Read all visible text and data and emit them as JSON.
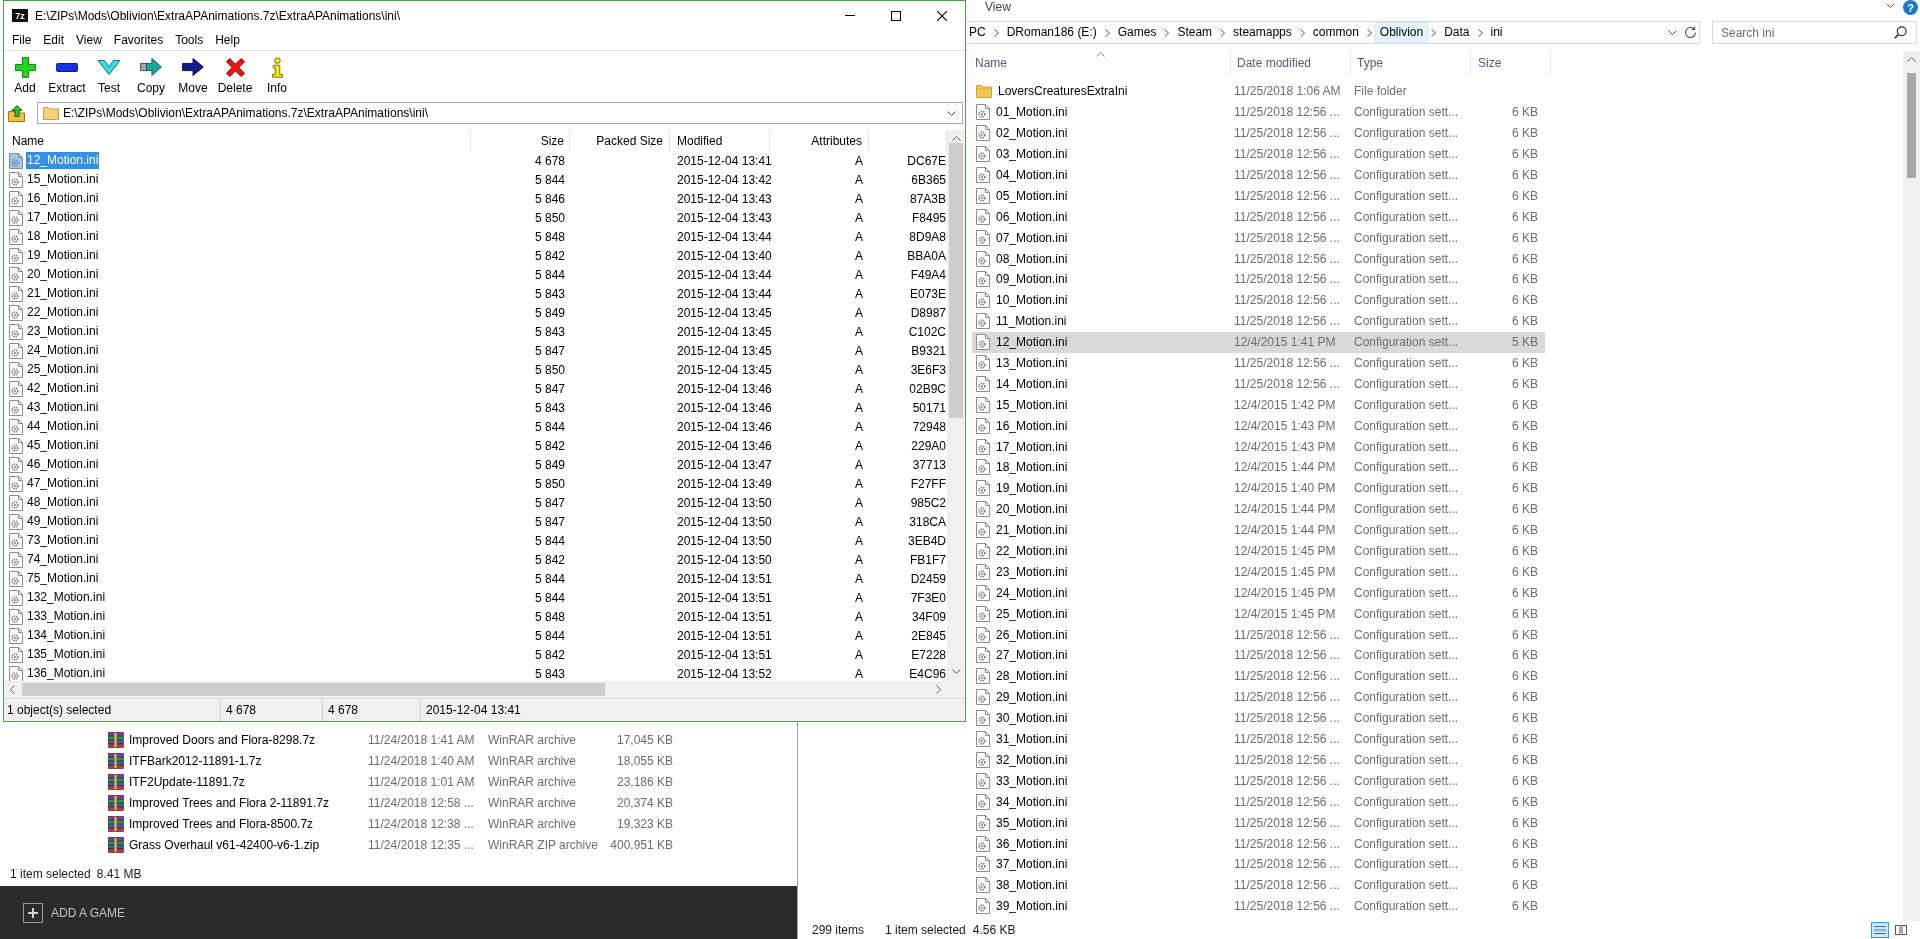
{
  "sevenzip": {
    "logo": "7z",
    "title": "E:\\ZIPs\\Mods\\Oblivion\\ExtraAPAnimations.7z\\ExtraAPAnimations\\ini\\",
    "menu": [
      "File",
      "Edit",
      "View",
      "Favorites",
      "Tools",
      "Help"
    ],
    "toolbar": [
      {
        "kind": "add",
        "label": "Add"
      },
      {
        "kind": "extract",
        "label": "Extract"
      },
      {
        "kind": "test",
        "label": "Test"
      },
      {
        "kind": "copy",
        "label": "Copy"
      },
      {
        "kind": "move",
        "label": "Move"
      },
      {
        "kind": "delete",
        "label": "Delete"
      },
      {
        "kind": "info",
        "label": "Info"
      }
    ],
    "path": "E:\\ZIPs\\Mods\\Oblivion\\ExtraAPAnimations.7z\\ExtraAPAnimations\\ini\\",
    "columns": [
      "Name",
      "Size",
      "Packed Size",
      "Modified",
      "Attributes"
    ],
    "rows": [
      {
        "name": "12_Motion.ini",
        "size": "4 678",
        "modified": "2015-12-04 13:41",
        "attributes": "A",
        "column_6": "DC67E",
        "selected": true
      },
      {
        "name": "15_Motion.ini",
        "size": "5 844",
        "modified": "2015-12-04 13:42",
        "attributes": "A",
        "column_6": "6B365",
        "selected": false
      },
      {
        "name": "16_Motion.ini",
        "size": "5 846",
        "modified": "2015-12-04 13:43",
        "attributes": "A",
        "column_6": "87A3B",
        "selected": false
      },
      {
        "name": "17_Motion.ini",
        "size": "5 850",
        "modified": "2015-12-04 13:43",
        "attributes": "A",
        "column_6": "F8495",
        "selected": false
      },
      {
        "name": "18_Motion.ini",
        "size": "5 848",
        "modified": "2015-12-04 13:44",
        "attributes": "A",
        "column_6": "8D9A8",
        "selected": false
      },
      {
        "name": "19_Motion.ini",
        "size": "5 842",
        "modified": "2015-12-04 13:40",
        "attributes": "A",
        "column_6": "BBA0A",
        "selected": false
      },
      {
        "name": "20_Motion.ini",
        "size": "5 844",
        "modified": "2015-12-04 13:44",
        "attributes": "A",
        "column_6": "F49A4",
        "selected": false
      },
      {
        "name": "21_Motion.ini",
        "size": "5 843",
        "modified": "2015-12-04 13:44",
        "attributes": "A",
        "column_6": "E073E",
        "selected": false
      },
      {
        "name": "22_Motion.ini",
        "size": "5 849",
        "modified": "2015-12-04 13:45",
        "attributes": "A",
        "column_6": "D8987",
        "selected": false
      },
      {
        "name": "23_Motion.ini",
        "size": "5 843",
        "modified": "2015-12-04 13:45",
        "attributes": "A",
        "column_6": "C102C",
        "selected": false
      },
      {
        "name": "24_Motion.ini",
        "size": "5 847",
        "modified": "2015-12-04 13:45",
        "attributes": "A",
        "column_6": "B9321",
        "selected": false
      },
      {
        "name": "25_Motion.ini",
        "size": "5 850",
        "modified": "2015-12-04 13:45",
        "attributes": "A",
        "column_6": "3E6F3",
        "selected": false
      },
      {
        "name": "42_Motion.ini",
        "size": "5 847",
        "modified": "2015-12-04 13:46",
        "attributes": "A",
        "column_6": "02B9C",
        "selected": false
      },
      {
        "name": "43_Motion.ini",
        "size": "5 843",
        "modified": "2015-12-04 13:46",
        "attributes": "A",
        "column_6": "50171",
        "selected": false
      },
      {
        "name": "44_Motion.ini",
        "size": "5 844",
        "modified": "2015-12-04 13:46",
        "attributes": "A",
        "column_6": "72948",
        "selected": false
      },
      {
        "name": "45_Motion.ini",
        "size": "5 842",
        "modified": "2015-12-04 13:46",
        "attributes": "A",
        "column_6": "229A0",
        "selected": false
      },
      {
        "name": "46_Motion.ini",
        "size": "5 849",
        "modified": "2015-12-04 13:47",
        "attributes": "A",
        "column_6": "37713",
        "selected": false
      },
      {
        "name": "47_Motion.ini",
        "size": "5 850",
        "modified": "2015-12-04 13:49",
        "attributes": "A",
        "column_6": "F27FF",
        "selected": false
      },
      {
        "name": "48_Motion.ini",
        "size": "5 847",
        "modified": "2015-12-04 13:50",
        "attributes": "A",
        "column_6": "985C2",
        "selected": false
      },
      {
        "name": "49_Motion.ini",
        "size": "5 847",
        "modified": "2015-12-04 13:50",
        "attributes": "A",
        "column_6": "318CA",
        "selected": false
      },
      {
        "name": "73_Motion.ini",
        "size": "5 844",
        "modified": "2015-12-04 13:50",
        "attributes": "A",
        "column_6": "3EB4D",
        "selected": false
      },
      {
        "name": "74_Motion.ini",
        "size": "5 842",
        "modified": "2015-12-04 13:50",
        "attributes": "A",
        "column_6": "FB1F7",
        "selected": false
      },
      {
        "name": "75_Motion.ini",
        "size": "5 844",
        "modified": "2015-12-04 13:51",
        "attributes": "A",
        "column_6": "D2459",
        "selected": false
      },
      {
        "name": "132_Motion.ini",
        "size": "5 844",
        "modified": "2015-12-04 13:51",
        "attributes": "A",
        "column_6": "7F3E0",
        "selected": false
      },
      {
        "name": "133_Motion.ini",
        "size": "5 848",
        "modified": "2015-12-04 13:51",
        "attributes": "A",
        "column_6": "34F09",
        "selected": false
      },
      {
        "name": "134_Motion.ini",
        "size": "5 844",
        "modified": "2015-12-04 13:51",
        "attributes": "A",
        "column_6": "2E845",
        "selected": false
      },
      {
        "name": "135_Motion.ini",
        "size": "5 842",
        "modified": "2015-12-04 13:51",
        "attributes": "A",
        "column_6": "E7228",
        "selected": false
      },
      {
        "name": "136_Motion.ini",
        "size": "5 843",
        "modified": "2015-12-04 13:52",
        "attributes": "A",
        "column_6": "E4C96",
        "selected": false
      }
    ],
    "status": [
      "1 object(s) selected",
      "4 678",
      "4 678",
      "2015-12-04 13:41"
    ]
  },
  "archive_window": {
    "rows": [
      {
        "name": "Improved Doors and Flora-8298.7z",
        "date": "11/24/2018 1:41 AM",
        "type": "WinRAR archive",
        "size": "17,045 KB"
      },
      {
        "name": "ITFBark2012-11891-1.7z",
        "date": "11/24/2018 1:40 AM",
        "type": "WinRAR archive",
        "size": "18,055 KB"
      },
      {
        "name": "ITF2Update-11891.7z",
        "date": "11/24/2018 1:01 AM",
        "type": "WinRAR archive",
        "size": "23,186 KB"
      },
      {
        "name": "Improved Trees and Flora 2-11891.7z",
        "date": "11/24/2018 12:58 ...",
        "type": "WinRAR archive",
        "size": "20,374 KB"
      },
      {
        "name": "Improved Trees and Flora-8500.7z",
        "date": "11/24/2018 12:38 ...",
        "type": "WinRAR archive",
        "size": "19,323 KB"
      },
      {
        "name": "Grass Overhaul v61-42400-v6-1.zip",
        "date": "11/24/2018 12:35 ...",
        "type": "WinRAR ZIP archive",
        "size": "400,951 KB"
      }
    ],
    "status": [
      "1 item selected",
      "8.41 MB"
    ]
  },
  "launcher": {
    "add_game": "ADD A GAME"
  },
  "explorer": {
    "ribbon_tab": "View",
    "help": "?",
    "breadcrumbs": [
      {
        "label": "PC",
        "selected": false
      },
      {
        "label": "DRoman186 (E:)",
        "selected": false
      },
      {
        "label": "Games",
        "selected": false
      },
      {
        "label": "Steam",
        "selected": false
      },
      {
        "label": "steamapps",
        "selected": false
      },
      {
        "label": "common",
        "selected": false
      },
      {
        "label": "Oblivion",
        "selected": true
      },
      {
        "label": "Data",
        "selected": false
      },
      {
        "label": "ini",
        "selected": false
      }
    ],
    "search": {
      "placeholder": "Search ini"
    },
    "columns": [
      "Name",
      "Date modified",
      "Type",
      "Size"
    ],
    "rows": [
      {
        "kind": "folder",
        "name": "LoversCreaturesExtraIni",
        "date": "11/25/2018 1:06 AM",
        "type": "File folder",
        "selected": false
      },
      {
        "kind": "file",
        "name": "01_Motion.ini",
        "date": "11/25/2018 12:56 ...",
        "type": "Configuration sett...",
        "size": "6 KB",
        "selected": false
      },
      {
        "kind": "file",
        "name": "02_Motion.ini",
        "date": "11/25/2018 12:56 ...",
        "type": "Configuration sett...",
        "size": "6 KB",
        "selected": false
      },
      {
        "kind": "file",
        "name": "03_Motion.ini",
        "date": "11/25/2018 12:56 ...",
        "type": "Configuration sett...",
        "size": "6 KB",
        "selected": false
      },
      {
        "kind": "file",
        "name": "04_Motion.ini",
        "date": "11/25/2018 12:56 ...",
        "type": "Configuration sett...",
        "size": "6 KB",
        "selected": false
      },
      {
        "kind": "file",
        "name": "05_Motion.ini",
        "date": "11/25/2018 12:56 ...",
        "type": "Configuration sett...",
        "size": "6 KB",
        "selected": false
      },
      {
        "kind": "file",
        "name": "06_Motion.ini",
        "date": "11/25/2018 12:56 ...",
        "type": "Configuration sett...",
        "size": "6 KB",
        "selected": false
      },
      {
        "kind": "file",
        "name": "07_Motion.ini",
        "date": "11/25/2018 12:56 ...",
        "type": "Configuration sett...",
        "size": "6 KB",
        "selected": false
      },
      {
        "kind": "file",
        "name": "08_Motion.ini",
        "date": "11/25/2018 12:56 ...",
        "type": "Configuration sett...",
        "size": "6 KB",
        "selected": false
      },
      {
        "kind": "file",
        "name": "09_Motion.ini",
        "date": "11/25/2018 12:56 ...",
        "type": "Configuration sett...",
        "size": "6 KB",
        "selected": false
      },
      {
        "kind": "file",
        "name": "10_Motion.ini",
        "date": "11/25/2018 12:56 ...",
        "type": "Configuration sett...",
        "size": "6 KB",
        "selected": false
      },
      {
        "kind": "file",
        "name": "11_Motion.ini",
        "date": "11/25/2018 12:56 ...",
        "type": "Configuration sett...",
        "size": "6 KB",
        "selected": false
      },
      {
        "kind": "file",
        "name": "12_Motion.ini",
        "date": "12/4/2015 1:41 PM",
        "type": "Configuration sett...",
        "size": "5 KB",
        "selected": true
      },
      {
        "kind": "file",
        "name": "13_Motion.ini",
        "date": "11/25/2018 12:56 ...",
        "type": "Configuration sett...",
        "size": "6 KB",
        "selected": false
      },
      {
        "kind": "file",
        "name": "14_Motion.ini",
        "date": "11/25/2018 12:56 ...",
        "type": "Configuration sett...",
        "size": "6 KB",
        "selected": false
      },
      {
        "kind": "file",
        "name": "15_Motion.ini",
        "date": "12/4/2015 1:42 PM",
        "type": "Configuration sett...",
        "size": "6 KB",
        "selected": false
      },
      {
        "kind": "file",
        "name": "16_Motion.ini",
        "date": "12/4/2015 1:43 PM",
        "type": "Configuration sett...",
        "size": "6 KB",
        "selected": false
      },
      {
        "kind": "file",
        "name": "17_Motion.ini",
        "date": "12/4/2015 1:43 PM",
        "type": "Configuration sett...",
        "size": "6 KB",
        "selected": false
      },
      {
        "kind": "file",
        "name": "18_Motion.ini",
        "date": "12/4/2015 1:44 PM",
        "type": "Configuration sett...",
        "size": "6 KB",
        "selected": false
      },
      {
        "kind": "file",
        "name": "19_Motion.ini",
        "date": "12/4/2015 1:40 PM",
        "type": "Configuration sett...",
        "size": "6 KB",
        "selected": false
      },
      {
        "kind": "file",
        "name": "20_Motion.ini",
        "date": "12/4/2015 1:44 PM",
        "type": "Configuration sett...",
        "size": "6 KB",
        "selected": false
      },
      {
        "kind": "file",
        "name": "21_Motion.ini",
        "date": "12/4/2015 1:44 PM",
        "type": "Configuration sett...",
        "size": "6 KB",
        "selected": false
      },
      {
        "kind": "file",
        "name": "22_Motion.ini",
        "date": "12/4/2015 1:45 PM",
        "type": "Configuration sett...",
        "size": "6 KB",
        "selected": false
      },
      {
        "kind": "file",
        "name": "23_Motion.ini",
        "date": "12/4/2015 1:45 PM",
        "type": "Configuration sett...",
        "size": "6 KB",
        "selected": false
      },
      {
        "kind": "file",
        "name": "24_Motion.ini",
        "date": "12/4/2015 1:45 PM",
        "type": "Configuration sett...",
        "size": "6 KB",
        "selected": false
      },
      {
        "kind": "file",
        "name": "25_Motion.ini",
        "date": "12/4/2015 1:45 PM",
        "type": "Configuration sett...",
        "size": "6 KB",
        "selected": false
      },
      {
        "kind": "file",
        "name": "26_Motion.ini",
        "date": "11/25/2018 12:56 ...",
        "type": "Configuration sett...",
        "size": "6 KB",
        "selected": false
      },
      {
        "kind": "file",
        "name": "27_Motion.ini",
        "date": "11/25/2018 12:56 ...",
        "type": "Configuration sett...",
        "size": "6 KB",
        "selected": false
      },
      {
        "kind": "file",
        "name": "28_Motion.ini",
        "date": "11/25/2018 12:56 ...",
        "type": "Configuration sett...",
        "size": "6 KB",
        "selected": false
      },
      {
        "kind": "file",
        "name": "29_Motion.ini",
        "date": "11/25/2018 12:56 ...",
        "type": "Configuration sett...",
        "size": "6 KB",
        "selected": false
      },
      {
        "kind": "file",
        "name": "30_Motion.ini",
        "date": "11/25/2018 12:56 ...",
        "type": "Configuration sett...",
        "size": "6 KB",
        "selected": false
      },
      {
        "kind": "file",
        "name": "31_Motion.ini",
        "date": "11/25/2018 12:56 ...",
        "type": "Configuration sett...",
        "size": "6 KB",
        "selected": false
      },
      {
        "kind": "file",
        "name": "32_Motion.ini",
        "date": "11/25/2018 12:56 ...",
        "type": "Configuration sett...",
        "size": "6 KB",
        "selected": false
      },
      {
        "kind": "file",
        "name": "33_Motion.ini",
        "date": "11/25/2018 12:56 ...",
        "type": "Configuration sett...",
        "size": "6 KB",
        "selected": false
      },
      {
        "kind": "file",
        "name": "34_Motion.ini",
        "date": "11/25/2018 12:56 ...",
        "type": "Configuration sett...",
        "size": "6 KB",
        "selected": false
      },
      {
        "kind": "file",
        "name": "35_Motion.ini",
        "date": "11/25/2018 12:56 ...",
        "type": "Configuration sett...",
        "size": "6 KB",
        "selected": false
      },
      {
        "kind": "file",
        "name": "36_Motion.ini",
        "date": "11/25/2018 12:56 ...",
        "type": "Configuration sett...",
        "size": "6 KB",
        "selected": false
      },
      {
        "kind": "file",
        "name": "37_Motion.ini",
        "date": "11/25/2018 12:56 ...",
        "type": "Configuration sett...",
        "size": "6 KB",
        "selected": false
      },
      {
        "kind": "file",
        "name": "38_Motion.ini",
        "date": "11/25/2018 12:56 ...",
        "type": "Configuration sett...",
        "size": "6 KB",
        "selected": false
      },
      {
        "kind": "file",
        "name": "39_Motion.ini",
        "date": "11/25/2018 12:56 ...",
        "type": "Configuration sett...",
        "size": "6 KB",
        "selected": false
      }
    ],
    "status": [
      "299 items",
      "1 item selected",
      "4.56 KB"
    ],
    "view_buttons": [
      {
        "kind": "details",
        "selected": true
      },
      {
        "kind": "large_icons",
        "selected": false
      }
    ]
  }
}
